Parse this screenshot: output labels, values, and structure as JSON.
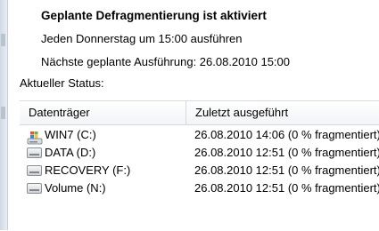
{
  "schedule": {
    "title": "Geplante Defragmentierung ist aktiviert",
    "frequency": "Jeden Donnerstag um 15:00 ausführen",
    "next_run": "Nächste geplante Ausführung: 26.08.2010 15:00"
  },
  "status": {
    "label": "Aktueller Status:",
    "columns": [
      "Datenträger",
      "Zuletzt ausgeführt"
    ],
    "rows": [
      {
        "drive": "WIN7 (C:)",
        "last_run": "26.08.2010 14:06 (0 % fragmentiert)",
        "icon": "windows-drive-icon"
      },
      {
        "drive": "DATA (D:)",
        "last_run": "26.08.2010 12:51 (0 % fragmentiert)",
        "icon": "hard-drive-icon"
      },
      {
        "drive": "RECOVERY (F:)",
        "last_run": "26.08.2010 12:51 (0 % fragmentiert)",
        "icon": "hard-drive-icon"
      },
      {
        "drive": "Volume (N:)",
        "last_run": "26.08.2010 12:51 (0 % fragmentiert)",
        "icon": "hard-drive-icon"
      }
    ]
  }
}
